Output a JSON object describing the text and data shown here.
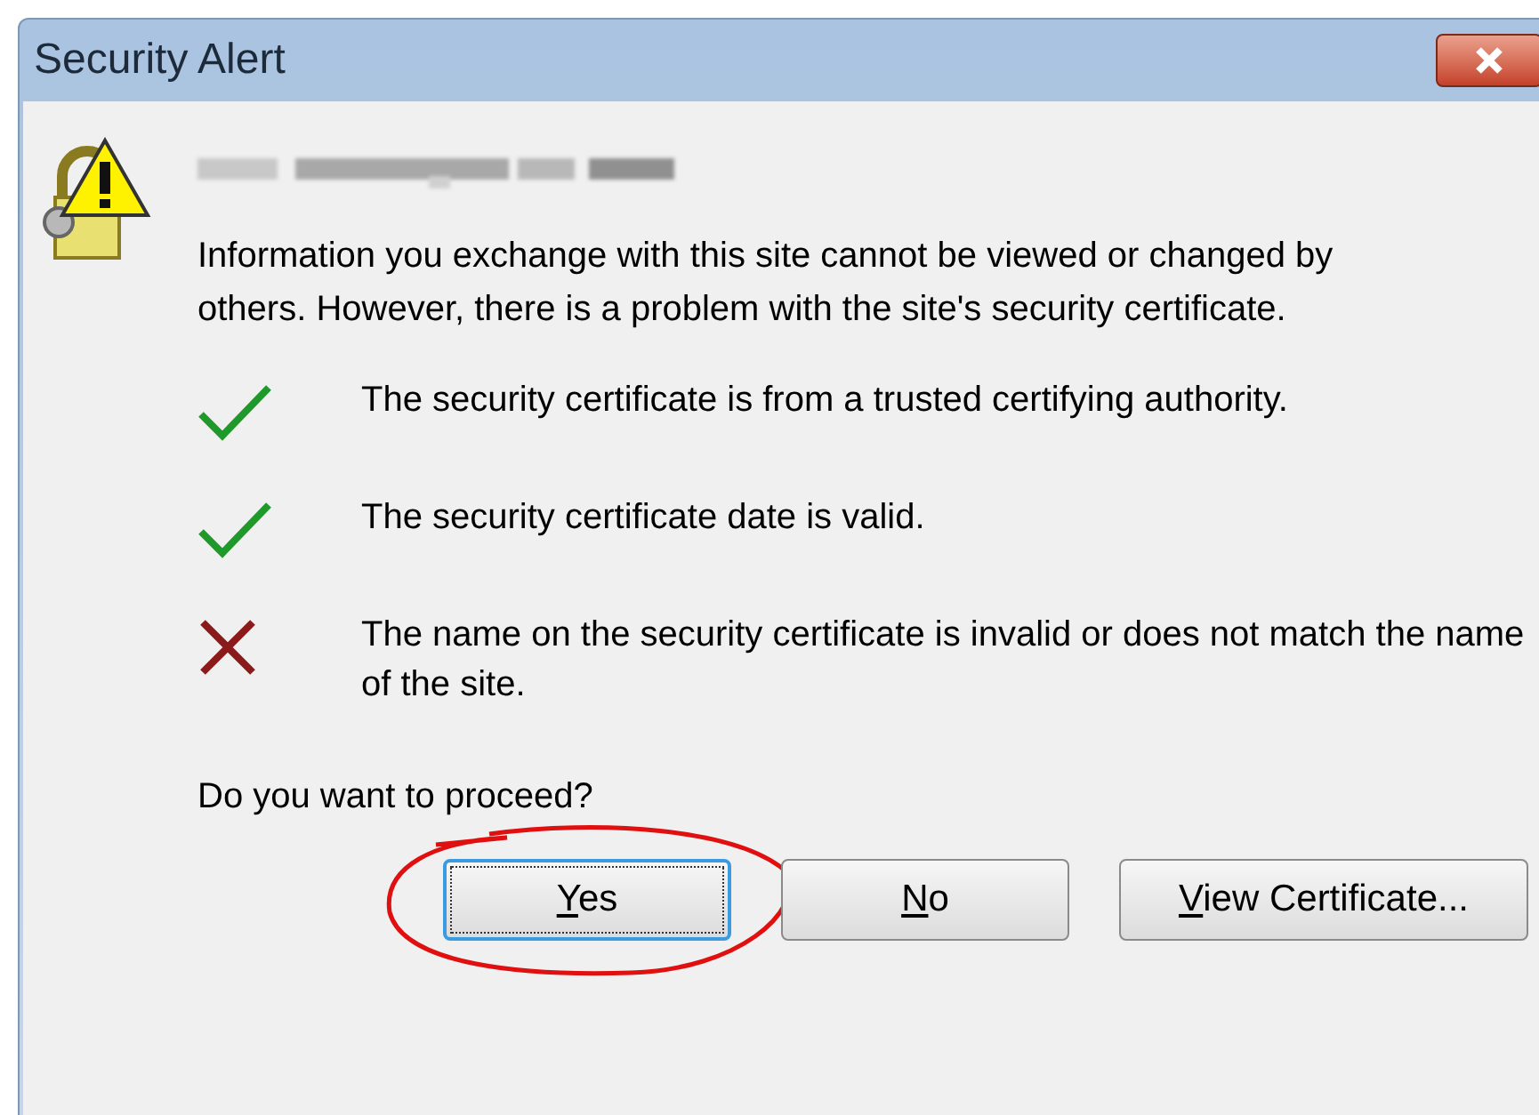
{
  "window": {
    "title": "Security Alert"
  },
  "message": "Information you exchange with this site cannot be viewed or changed by others. However, there is a problem with the site's security certificate.",
  "checks": [
    {
      "kind": "pass",
      "text": "The security certificate is from a trusted certifying authority."
    },
    {
      "kind": "pass",
      "text": "The security certificate date is valid."
    },
    {
      "kind": "fail",
      "text": "The name on the security certificate is invalid or does not match the name of the site."
    }
  ],
  "question": "Do you want to proceed?",
  "buttons": [
    {
      "underlined": "Y",
      "rest": "es",
      "default": true,
      "circled": true
    },
    {
      "underlined": "N",
      "rest": "o",
      "default": false,
      "circled": false
    },
    {
      "underlined": "V",
      "rest": "iew Certificate...",
      "default": false,
      "circled": false
    }
  ]
}
